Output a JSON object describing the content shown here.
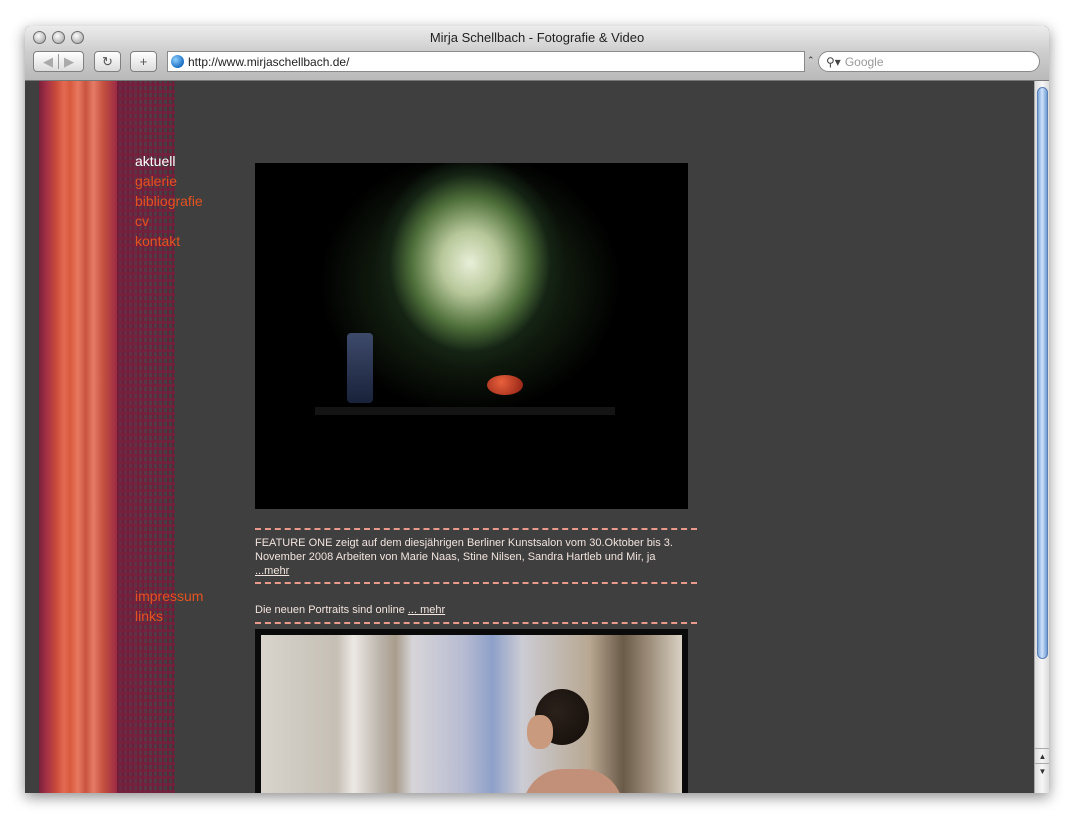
{
  "window": {
    "title": "Mirja Schellbach - Fotografie & Video"
  },
  "toolbar": {
    "back_icon": "back-arrow-icon",
    "forward_icon": "forward-arrow-icon",
    "reload_glyph": "↻",
    "add_glyph": "+",
    "url": "http://www.mirjaschellbach.de/",
    "search_placeholder": "Google"
  },
  "nav": {
    "items": [
      {
        "label": "aktuell",
        "active": true
      },
      {
        "label": "galerie"
      },
      {
        "label": "bibliografie"
      },
      {
        "label": "cv"
      },
      {
        "label": "kontakt"
      }
    ],
    "footer_items": [
      {
        "label": "impressum"
      },
      {
        "label": "links"
      }
    ]
  },
  "news": {
    "item1_text": "FEATURE ONE zeigt auf dem diesjährigen Berliner Kunstsalon vom 30.Oktober bis 3. November 2008 Arbeiten von Marie Naas, Stine Nilsen, Sandra Hartleb und Mir, ja",
    "item1_link": "...mehr",
    "item2_text": "Die neuen Portraits sind online ",
    "item2_link": "... mehr"
  },
  "colors": {
    "page_bg": "#3f3f3f",
    "nav_link": "#e4531f",
    "nav_active": "#ffffff",
    "news_text": "#f2e4de",
    "divider": "#e99a8a"
  }
}
